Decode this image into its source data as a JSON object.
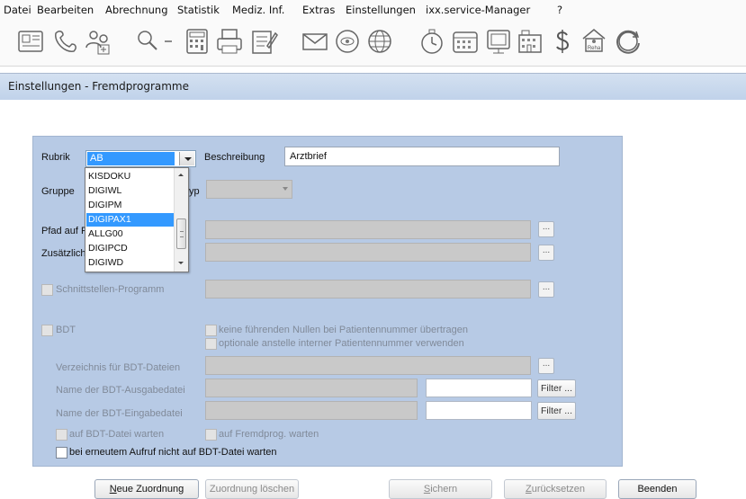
{
  "menu": [
    "Datei",
    "Bearbeiten",
    "Abrechnung",
    "Statistik",
    "Mediz. Inf.",
    "Extras",
    "Einstellungen",
    "ixx.service-Manager",
    "?"
  ],
  "toolbar_icons": [
    "patient-card-icon",
    "phone-icon",
    "users-add-icon",
    "search-dropdown-icon",
    "calculator-icon",
    "printer-icon",
    "notepad-icon",
    "mail-icon",
    "money-icon",
    "globe-icon",
    "timer-icon",
    "calendar-icon",
    "presentation-icon",
    "building-icon",
    "dollar-icon",
    "reha-icon",
    "refresh-globe-icon"
  ],
  "toolbar_labels": {
    "reha": "Reha"
  },
  "window_title": "Einstellungen - Fremdprogramme",
  "form": {
    "rubrik_label": "Rubrik",
    "rubrik_value": "AB",
    "beschreibung_label": "Beschreibung",
    "beschreibung_value": "Arztbrief",
    "gruppe_label": "Gruppe",
    "typ_label_partial": "yp",
    "pfad_label_partial": "Pfad auf F",
    "zusaetzlich_label_partial": "Zusätzlich",
    "schnittstelle_label": "Schnittstellen-Programm",
    "bdt_label": "BDT",
    "keine_nullen_label": "keine führenden Nullen bei Patientennummer übertragen",
    "optionale_label": "optionale anstelle interner Patientennummer verwenden",
    "verzeichnis_label": "Verzeichnis für BDT-Dateien",
    "ausgabe_label": "Name der BDT-Ausgabedatei",
    "eingabe_label": "Name der BDT-Eingabedatei",
    "filter_label": "Filter ...",
    "dots_label": "...",
    "auf_bdt_label": "auf BDT-Datei warten",
    "auf_fremd_label": "auf Fremdprog. warten",
    "erneut_label": "bei erneutem Aufruf nicht auf BDT-Datei warten"
  },
  "dropdown_items": [
    "KISDOKU",
    "DIGIWL",
    "DIGIPM",
    "DIGIPAX1",
    "ALLG00",
    "DIGIPCD",
    "DIGIWD"
  ],
  "dropdown_highlighted": "DIGIPAX1",
  "buttons": {
    "neue": "Neue Zuordnung",
    "loeschen": "Zuordnung löschen",
    "sichern": "Sichern",
    "zurueck": "Zurücksetzen",
    "beenden": "Beenden"
  },
  "colors": {
    "panel": "#b7cae5",
    "titlebar": "#c8d8ee",
    "selection": "#3399ff"
  }
}
